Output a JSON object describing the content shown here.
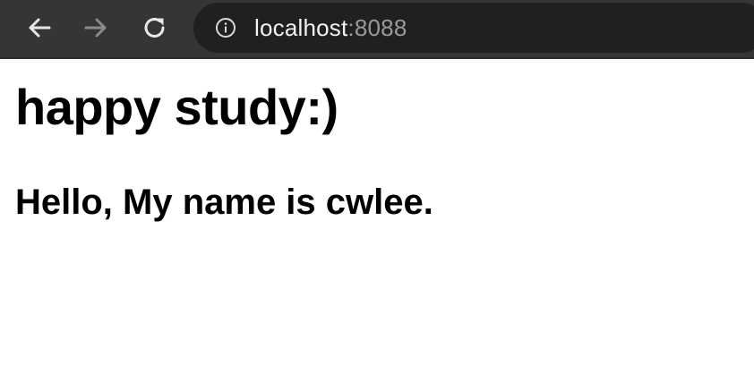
{
  "browser": {
    "url_host": "localhost",
    "url_port": ":8088",
    "icons": {
      "back": "arrow-left-icon",
      "forward": "arrow-right-icon",
      "reload": "reload-icon",
      "info": "info-icon"
    },
    "colors": {
      "toolbar": "#353535",
      "omnibox": "#202020",
      "host_text": "#f2f2f2",
      "port_text": "#9a9a9a"
    }
  },
  "page": {
    "heading": "happy study:)",
    "subheading": "Hello, My name is cwlee."
  }
}
